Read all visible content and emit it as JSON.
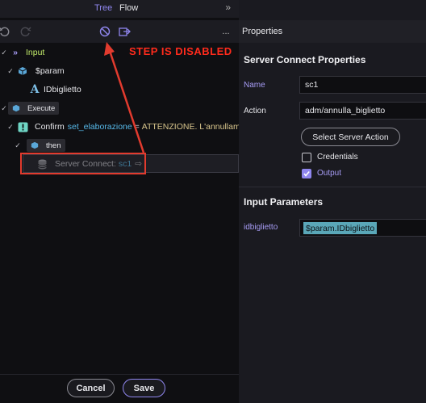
{
  "tabs": {
    "tree": "Tree",
    "flow": "Flow"
  },
  "toolbar": {
    "more": "..."
  },
  "tree": {
    "input": "Input",
    "param": "$param",
    "param_child": "IDbiglietto",
    "execute": "Execute",
    "confirm_label": "Confirm",
    "confirm_var": "set_elaborazione",
    "confirm_eq": " = ",
    "confirm_msg": "ATTENZIONE. L'annullame",
    "then": "then",
    "sc_label": "Server Connect:",
    "sc_name": "sc1"
  },
  "annotation": "STEP IS DISABLED",
  "footer": {
    "cancel": "Cancel",
    "save": "Save"
  },
  "properties": {
    "header": "Properties",
    "section_title": "Server Connect Properties",
    "name_label": "Name",
    "name_value": "sc1",
    "action_label": "Action",
    "action_value": "adm/annulla_biglietto",
    "select_button": "Select Server Action",
    "credentials_label": "Credentials",
    "credentials_checked": false,
    "output_label": "Output",
    "output_checked": true,
    "input_params_title": "Input Parameters",
    "param_name": "idbiglietto",
    "param_value": "$param.IDbiglietto"
  },
  "colors": {
    "accent": "#8f86ee",
    "annotation": "#ff2b1c",
    "keyword": "#56b8e8",
    "string": "#d8c58c",
    "chip": "#5aa7b8"
  }
}
